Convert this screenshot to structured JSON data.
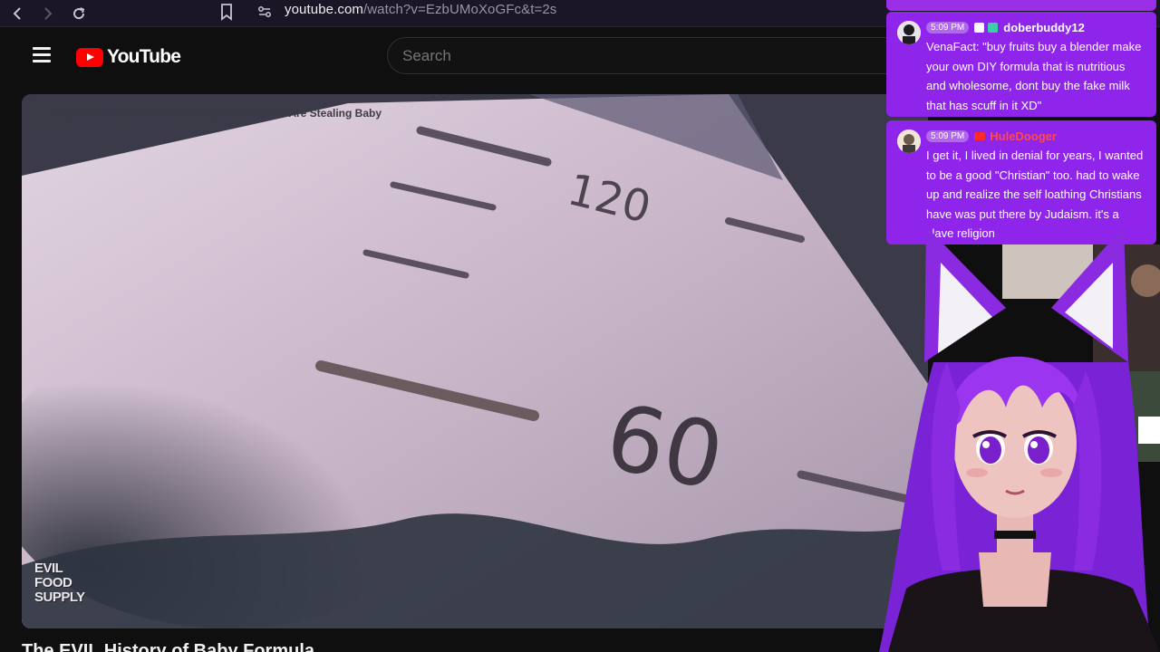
{
  "browser": {
    "url_host": "youtube.com",
    "url_path": "/watch?v=EzbUMoXoGFc&t=2s"
  },
  "youtube": {
    "logo_text": "YouTube",
    "search_placeholder": "Search"
  },
  "video": {
    "credit": "Sky News - Baby Formula Desperate Parents Are Stealing Baby",
    "watermark_lines": [
      "EVIL",
      "FOOD",
      "SUPPLY"
    ],
    "frame_numbers": [
      "120",
      "60"
    ],
    "title": "The EVIL History of Baby Formula"
  },
  "chat": {
    "messages": [
      {
        "time": "5:09 PM",
        "user": "doberbuddy12",
        "platform": "twitch",
        "text": "VenaFact: \"buy fruits buy a blender make your own DIY formula that is nutritious and wholesome, dont buy the fake milk that has scuff in it XD\""
      },
      {
        "time": "5:09 PM",
        "user": "HuleDooger",
        "platform": "youtube",
        "text": "I get it, I lived in denial for years, I wanted to be a good \"Christian\" too. had to wake up and realize the self loathing Christians have was put there by Judaism. it's a slave religion"
      }
    ]
  },
  "colors": {
    "chat_bg": "#8f24ea",
    "avatar_hair": "#8a2be2",
    "yt_red": "#ff0000"
  }
}
